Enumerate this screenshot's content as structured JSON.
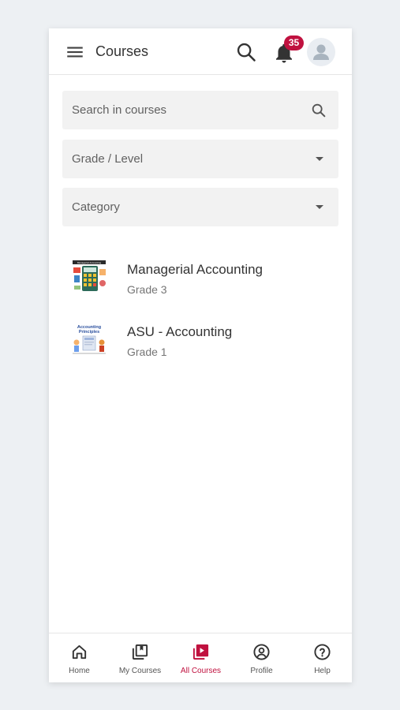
{
  "appbar": {
    "title": "Courses",
    "notification_count": "35"
  },
  "filters": {
    "search_placeholder": "Search in courses",
    "grade_label": "Grade / Level",
    "category_label": "Category"
  },
  "courses": [
    {
      "name": "Managerial Accounting",
      "grade": "Grade 3",
      "thumbnail": "managerial-accounting-thumbnail"
    },
    {
      "name": "ASU - Accounting",
      "grade": "Grade 1",
      "thumbnail": "accounting-principles-thumbnail"
    }
  ],
  "thumb_text": {
    "managerial": "Managerial Accounting",
    "principles_line1": "Accounting",
    "principles_line2": "Principles"
  },
  "nav": [
    {
      "label": "Home",
      "icon": "home-icon",
      "active": false
    },
    {
      "label": "My Courses",
      "icon": "library-icon",
      "active": false
    },
    {
      "label": "All Courses",
      "icon": "play-library-icon",
      "active": true
    },
    {
      "label": "Profile",
      "icon": "account-circle-icon",
      "active": false
    },
    {
      "label": "Help",
      "icon": "help-circle-icon",
      "active": false
    }
  ],
  "colors": {
    "accent": "#c0113f",
    "background": "#edf0f3",
    "field_bg": "#f2f2f2"
  }
}
